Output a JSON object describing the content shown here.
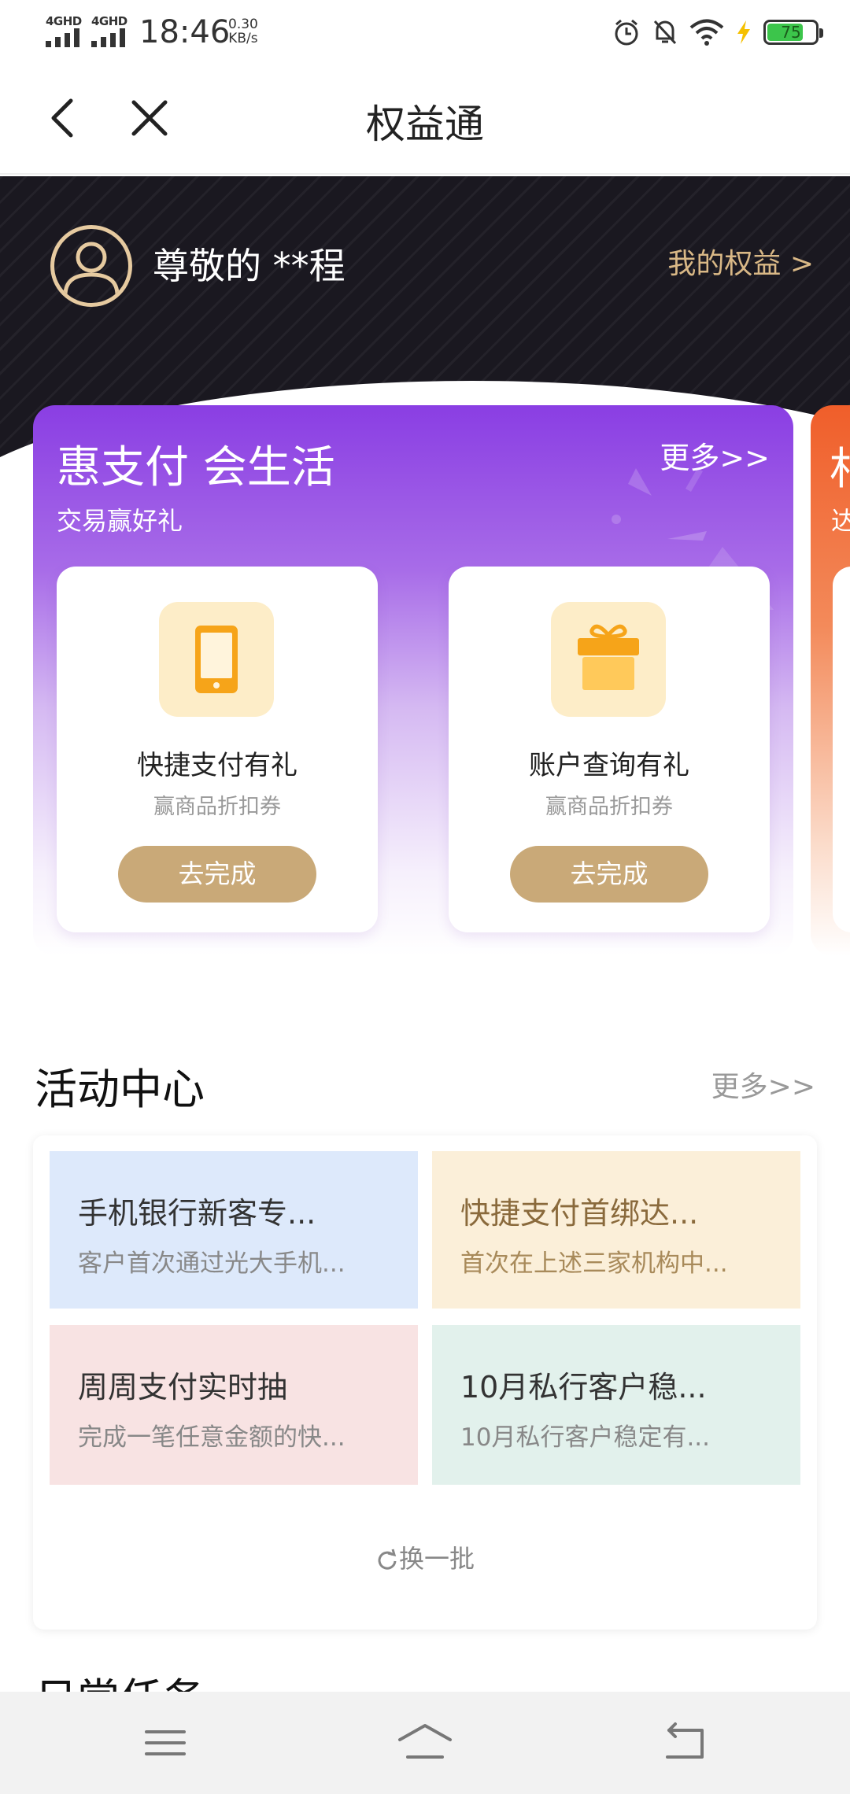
{
  "status_bar": {
    "network_1": "4GHD",
    "network_2": "4GHD",
    "time": "18:46",
    "speed_value": "0.30",
    "speed_unit": "KB/s",
    "battery": "75"
  },
  "nav": {
    "title": "权益通"
  },
  "header": {
    "greeting": "尊敬的 **程",
    "my_benefits": "我的权益 >"
  },
  "promo": {
    "title": "惠支付 会生活",
    "subtitle": "交易赢好礼",
    "more": "更多>>",
    "next_card_title_partial": "村",
    "next_card_sub_partial": "达",
    "tasks": [
      {
        "name": "快捷支付有礼",
        "desc": "赢商品折扣券",
        "button": "去完成",
        "icon": "phone-icon"
      },
      {
        "name": "账户查询有礼",
        "desc": "赢商品折扣券",
        "button": "去完成",
        "icon": "gift-icon"
      }
    ]
  },
  "activity": {
    "title": "活动中心",
    "more": "更多>>",
    "items": [
      {
        "title": "手机银行新客专...",
        "desc": "客户首次通过光大手机..."
      },
      {
        "title": "快捷支付首绑达...",
        "desc": "首次在上述三家机构中..."
      },
      {
        "title": "周周支付实时抽",
        "desc": "完成一笔任意金额的快..."
      },
      {
        "title": "10月私行客户稳...",
        "desc": "10月私行客户稳定有..."
      }
    ],
    "refresh": "换一批"
  },
  "daily": {
    "title_partial": "日常任务"
  },
  "colors": {
    "gold": "#c9a978",
    "purple": "#8a3ee3",
    "hero_dark": "#1a1820"
  }
}
